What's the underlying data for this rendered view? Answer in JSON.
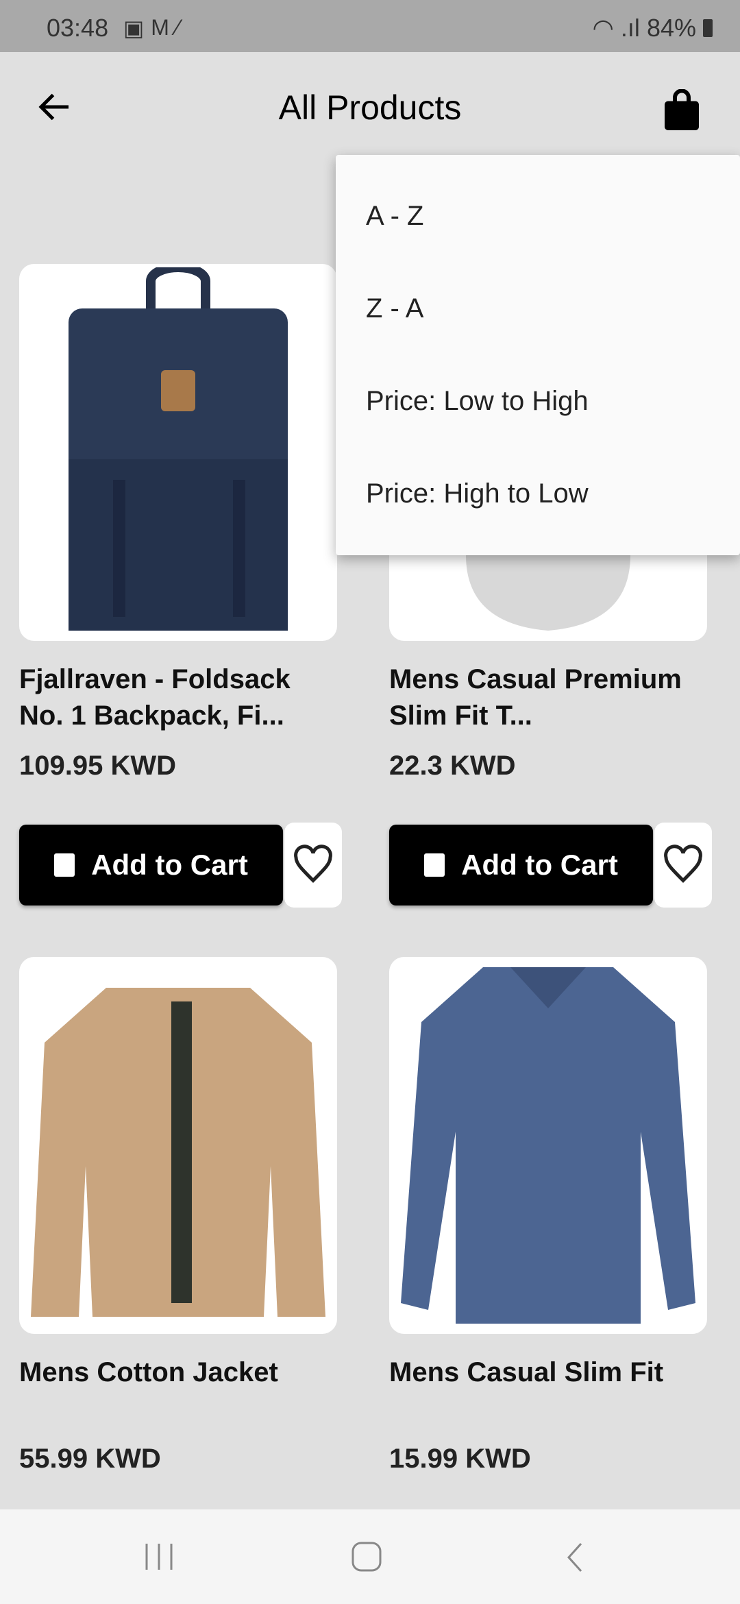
{
  "status": {
    "time": "03:48",
    "battery": "84%"
  },
  "header": {
    "title": "All Products"
  },
  "sort_menu": {
    "items": [
      "A - Z",
      "Z - A",
      "Price: Low to High",
      "Price: High to Low"
    ]
  },
  "products": [
    {
      "name": "Fjallraven - Foldsack No. 1 Backpack, Fi...",
      "price": "109.95 KWD"
    },
    {
      "name": "Mens Casual Premium Slim Fit T...",
      "price": "22.3 KWD"
    },
    {
      "name": "Mens Cotton Jacket",
      "price": "55.99 KWD"
    },
    {
      "name": "Mens Casual Slim Fit",
      "price": "15.99 KWD"
    }
  ],
  "buttons": {
    "add_to_cart": "Add to Cart"
  }
}
